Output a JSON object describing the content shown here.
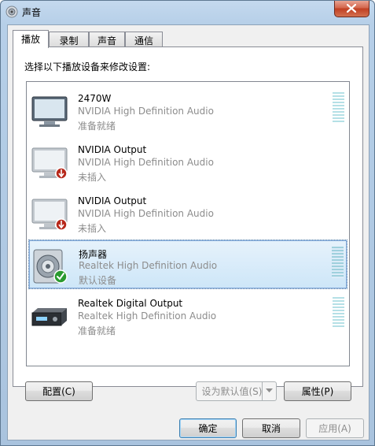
{
  "window": {
    "title": "声音"
  },
  "tabs": [
    {
      "label": "播放",
      "active": true
    },
    {
      "label": "录制",
      "active": false
    },
    {
      "label": "声音",
      "active": false
    },
    {
      "label": "通信",
      "active": false
    }
  ],
  "instruction": "选择以下播放设备来修改设置:",
  "devices": [
    {
      "name": "2470W",
      "description": "NVIDIA High Definition Audio",
      "status": "准备就绪",
      "icon": "monitor-icon"
    },
    {
      "name": "NVIDIA Output",
      "description": "NVIDIA High Definition Audio",
      "status": "未插入",
      "icon": "monitor-unplugged-icon"
    },
    {
      "name": "NVIDIA Output",
      "description": "NVIDIA High Definition Audio",
      "status": "未插入",
      "icon": "monitor-unplugged-icon"
    },
    {
      "name": "扬声器",
      "description": "Realtek High Definition Audio",
      "status": "默认设备",
      "icon": "speaker-default-icon",
      "selected": true
    },
    {
      "name": "Realtek Digital Output",
      "description": "Realtek High Definition Audio",
      "status": "准备就绪",
      "icon": "digital-output-icon"
    }
  ],
  "buttons": {
    "configure": "配置(C)",
    "set_default": "设为默认值(S)",
    "properties": "属性(P)",
    "ok": "确定",
    "cancel": "取消",
    "apply": "应用(A)"
  },
  "colors": {
    "selection": "#cde6f8",
    "meter": "#b5e0e6",
    "close": "#c03f22"
  }
}
